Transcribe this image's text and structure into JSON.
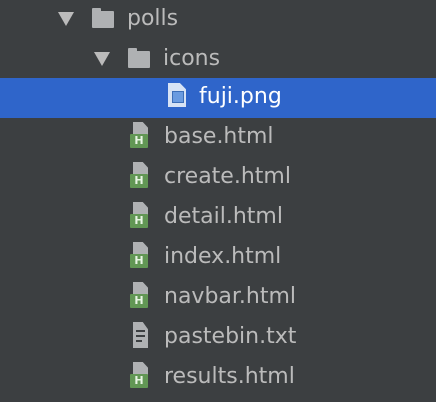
{
  "tree": {
    "polls": {
      "label": "polls",
      "expanded": true
    },
    "icons": {
      "label": "icons",
      "expanded": true
    },
    "files": [
      {
        "label": "fuji.png",
        "type": "image",
        "selected": true
      },
      {
        "label": "base.html",
        "type": "html"
      },
      {
        "label": "create.html",
        "type": "html"
      },
      {
        "label": "detail.html",
        "type": "html"
      },
      {
        "label": "index.html",
        "type": "html"
      },
      {
        "label": "navbar.html",
        "type": "html"
      },
      {
        "label": "pastebin.txt",
        "type": "text"
      },
      {
        "label": "results.html",
        "type": "html"
      }
    ]
  },
  "colors": {
    "background": "#3c3f41",
    "selection": "#2f65ca",
    "html_badge": "#629755",
    "text": "#bbbbbb",
    "selected_text": "#ffffff"
  }
}
